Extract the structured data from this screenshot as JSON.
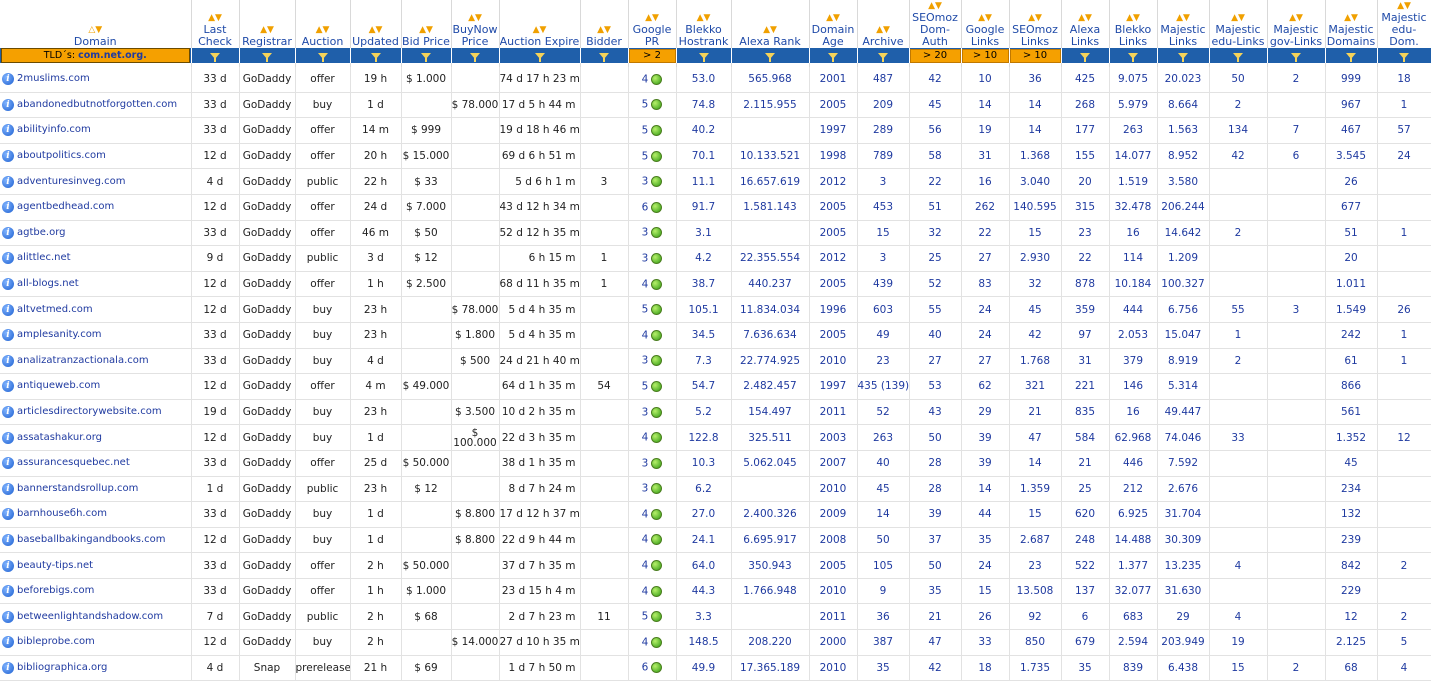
{
  "columns": [
    {
      "label": "Domain",
      "filter": "TLD´s: com.net.org."
    },
    {
      "label": "Last Check"
    },
    {
      "label": "Registrar"
    },
    {
      "label": "Auction"
    },
    {
      "label": "Updated"
    },
    {
      "label": "Bid Price"
    },
    {
      "label": "BuyNow Price"
    },
    {
      "label": "Auction Expire"
    },
    {
      "label": "Bidder"
    },
    {
      "label": "Google PR",
      "filter": "> 2"
    },
    {
      "label": "Blekko Hostrank"
    },
    {
      "label": "Alexa Rank"
    },
    {
      "label": "Domain Age"
    },
    {
      "label": "Archive"
    },
    {
      "label": "SEOmoz Dom-Auth",
      "filter": "> 20"
    },
    {
      "label": "Google Links",
      "filter": "> 10"
    },
    {
      "label": "SEOmoz Links",
      "filter": "> 10"
    },
    {
      "label": "Alexa Links"
    },
    {
      "label": "Blekko Links"
    },
    {
      "label": "Majestic Links"
    },
    {
      "label": "Majestic edu-Links"
    },
    {
      "label": "Majestic gov-Links"
    },
    {
      "label": "Majestic Domains"
    },
    {
      "label": "Majestic edu-Dom."
    }
  ],
  "tld_prefix": "TLD´s:",
  "tld_value": "com.net.org.",
  "rows": [
    [
      "2muslims.com",
      "33 d",
      "GoDaddy",
      "offer",
      "19 h",
      "$ 1.000",
      "",
      "74 d 17 h 23 m",
      "",
      "4",
      "53.0",
      "565.968",
      "2001",
      "487",
      "42",
      "10",
      "36",
      "425",
      "9.075",
      "20.023",
      "50",
      "2",
      "999",
      "18"
    ],
    [
      "abandonedbutnotforgotten.com",
      "33 d",
      "GoDaddy",
      "buy",
      "1 d",
      "",
      "$ 78.000",
      "17 d 5 h 44 m",
      "",
      "5",
      "74.8",
      "2.115.955",
      "2005",
      "209",
      "45",
      "14",
      "14",
      "268",
      "5.979",
      "8.664",
      "2",
      "",
      "967",
      "1"
    ],
    [
      "abilityinfo.com",
      "33 d",
      "GoDaddy",
      "offer",
      "14 m",
      "$ 999",
      "",
      "19 d 18 h 46 m",
      "",
      "5",
      "40.2",
      "",
      "1997",
      "289",
      "56",
      "19",
      "14",
      "177",
      "263",
      "1.563",
      "134",
      "7",
      "467",
      "57"
    ],
    [
      "aboutpolitics.com",
      "12 d",
      "GoDaddy",
      "offer",
      "20 h",
      "$ 15.000",
      "",
      "69 d 6 h 51 m",
      "",
      "5",
      "70.1",
      "10.133.521",
      "1998",
      "789",
      "58",
      "31",
      "1.368",
      "155",
      "14.077",
      "8.952",
      "42",
      "6",
      "3.545",
      "24"
    ],
    [
      "adventuresinveg.com",
      "4 d",
      "GoDaddy",
      "public",
      "22 h",
      "$ 33",
      "",
      "5 d 6 h 1 m",
      "3",
      "3",
      "11.1",
      "16.657.619",
      "2012",
      "3",
      "22",
      "16",
      "3.040",
      "20",
      "1.519",
      "3.580",
      "",
      "",
      "26",
      ""
    ],
    [
      "agentbedhead.com",
      "12 d",
      "GoDaddy",
      "offer",
      "24 d",
      "$ 7.000",
      "",
      "43 d 12 h 34 m",
      "",
      "6",
      "91.7",
      "1.581.143",
      "2005",
      "453",
      "51",
      "262",
      "140.595",
      "315",
      "32.478",
      "206.244",
      "",
      "",
      "677",
      ""
    ],
    [
      "agtbe.org",
      "33 d",
      "GoDaddy",
      "offer",
      "46 m",
      "$ 50",
      "",
      "52 d 12 h 35 m",
      "",
      "3",
      "3.1",
      "",
      "2005",
      "15",
      "32",
      "22",
      "15",
      "23",
      "16",
      "14.642",
      "2",
      "",
      "51",
      "1"
    ],
    [
      "alittlec.net",
      "9 d",
      "GoDaddy",
      "public",
      "3 d",
      "$ 12",
      "",
      "6 h 15 m",
      "1",
      "3",
      "4.2",
      "22.355.554",
      "2012",
      "3",
      "25",
      "27",
      "2.930",
      "22",
      "114",
      "1.209",
      "",
      "",
      "20",
      ""
    ],
    [
      "all-blogs.net",
      "12 d",
      "GoDaddy",
      "offer",
      "1 h",
      "$ 2.500",
      "",
      "68 d 11 h 35 m",
      "1",
      "4",
      "38.7",
      "440.237",
      "2005",
      "439",
      "52",
      "83",
      "32",
      "878",
      "10.184",
      "100.327",
      "",
      "",
      "1.011",
      ""
    ],
    [
      "altvetmed.com",
      "12 d",
      "GoDaddy",
      "buy",
      "23 h",
      "",
      "$ 78.000",
      "5 d 4 h 35 m",
      "",
      "5",
      "105.1",
      "11.834.034",
      "1996",
      "603",
      "55",
      "24",
      "45",
      "359",
      "444",
      "6.756",
      "55",
      "3",
      "1.549",
      "26"
    ],
    [
      "amplesanity.com",
      "33 d",
      "GoDaddy",
      "buy",
      "23 h",
      "",
      "$ 1.800",
      "5 d 4 h 35 m",
      "",
      "4",
      "34.5",
      "7.636.634",
      "2005",
      "49",
      "40",
      "24",
      "42",
      "97",
      "2.053",
      "15.047",
      "1",
      "",
      "242",
      "1"
    ],
    [
      "analizatranzactionala.com",
      "33 d",
      "GoDaddy",
      "buy",
      "4 d",
      "",
      "$ 500",
      "24 d 21 h 40 m",
      "",
      "3",
      "7.3",
      "22.774.925",
      "2010",
      "23",
      "27",
      "27",
      "1.768",
      "31",
      "379",
      "8.919",
      "2",
      "",
      "61",
      "1"
    ],
    [
      "antiqueweb.com",
      "12 d",
      "GoDaddy",
      "offer",
      "4 m",
      "$ 49.000",
      "",
      "64 d 1 h 35 m",
      "54",
      "5",
      "54.7",
      "2.482.457",
      "1997",
      "435 (139)",
      "53",
      "62",
      "321",
      "221",
      "146",
      "5.314",
      "",
      "",
      "866",
      ""
    ],
    [
      "articlesdirectorywebsite.com",
      "19 d",
      "GoDaddy",
      "buy",
      "23 h",
      "",
      "$ 3.500",
      "10 d 2 h 35 m",
      "",
      "3",
      "5.2",
      "154.497",
      "2011",
      "52",
      "43",
      "29",
      "21",
      "835",
      "16",
      "49.447",
      "",
      "",
      "561",
      ""
    ],
    [
      "assatashakur.org",
      "12 d",
      "GoDaddy",
      "buy",
      "1 d",
      "",
      "$ 100.000",
      "22 d 3 h 35 m",
      "",
      "4",
      "122.8",
      "325.511",
      "2003",
      "263",
      "50",
      "39",
      "47",
      "584",
      "62.968",
      "74.046",
      "33",
      "",
      "1.352",
      "12"
    ],
    [
      "assurancesquebec.net",
      "33 d",
      "GoDaddy",
      "offer",
      "25 d",
      "$ 50.000",
      "",
      "38 d 1 h 35 m",
      "",
      "3",
      "10.3",
      "5.062.045",
      "2007",
      "40",
      "28",
      "39",
      "14",
      "21",
      "446",
      "7.592",
      "",
      "",
      "45",
      ""
    ],
    [
      "bannerstandsrollup.com",
      "1 d",
      "GoDaddy",
      "public",
      "23 h",
      "$ 12",
      "",
      "8 d 7 h 24 m",
      "",
      "3",
      "6.2",
      "",
      "2010",
      "45",
      "28",
      "14",
      "1.359",
      "25",
      "212",
      "2.676",
      "",
      "",
      "234",
      ""
    ],
    [
      "barnhouseбh.com",
      "33 d",
      "GoDaddy",
      "buy",
      "1 d",
      "",
      "$ 8.800",
      "17 d 12 h 37 m",
      "",
      "4",
      "27.0",
      "2.400.326",
      "2009",
      "14",
      "39",
      "44",
      "15",
      "620",
      "6.925",
      "31.704",
      "",
      "",
      "132",
      ""
    ],
    [
      "baseballbakingandbooks.com",
      "12 d",
      "GoDaddy",
      "buy",
      "1 d",
      "",
      "$ 8.800",
      "22 d 9 h 44 m",
      "",
      "4",
      "24.1",
      "6.695.917",
      "2008",
      "50",
      "37",
      "35",
      "2.687",
      "248",
      "14.488",
      "30.309",
      "",
      "",
      "239",
      ""
    ],
    [
      "beauty-tips.net",
      "33 d",
      "GoDaddy",
      "offer",
      "2 h",
      "$ 50.000",
      "",
      "37 d 7 h 35 m",
      "",
      "4",
      "64.0",
      "350.943",
      "2005",
      "105",
      "50",
      "24",
      "23",
      "522",
      "1.377",
      "13.235",
      "4",
      "",
      "842",
      "2"
    ],
    [
      "beforebigs.com",
      "33 d",
      "GoDaddy",
      "offer",
      "1 h",
      "$ 1.000",
      "",
      "23 d 15 h 4 m",
      "",
      "4",
      "44.3",
      "1.766.948",
      "2010",
      "9",
      "35",
      "15",
      "13.508",
      "137",
      "32.077",
      "31.630",
      "",
      "",
      "229",
      ""
    ],
    [
      "betweenlightandshadow.com",
      "7 d",
      "GoDaddy",
      "public",
      "2 h",
      "$ 68",
      "",
      "2 d 7 h 23 m",
      "11",
      "5",
      "3.3",
      "",
      "2011",
      "36",
      "21",
      "26",
      "92",
      "6",
      "683",
      "29",
      "4",
      "",
      "12",
      "2"
    ],
    [
      "bibleprobe.com",
      "12 d",
      "GoDaddy",
      "buy",
      "2 h",
      "",
      "$ 14.000",
      "27 d 10 h 35 m",
      "",
      "4",
      "148.5",
      "208.220",
      "2000",
      "387",
      "47",
      "33",
      "850",
      "679",
      "2.594",
      "203.949",
      "19",
      "",
      "2.125",
      "5"
    ],
    [
      "bibliographica.org",
      "4 d",
      "Snap",
      "prerelease",
      "21 h",
      "$ 69",
      "",
      "1 d 7 h 50 m",
      "",
      "6",
      "49.9",
      "17.365.189",
      "2010",
      "35",
      "42",
      "18",
      "1.735",
      "35",
      "839",
      "6.438",
      "15",
      "2",
      "68",
      "4"
    ]
  ]
}
